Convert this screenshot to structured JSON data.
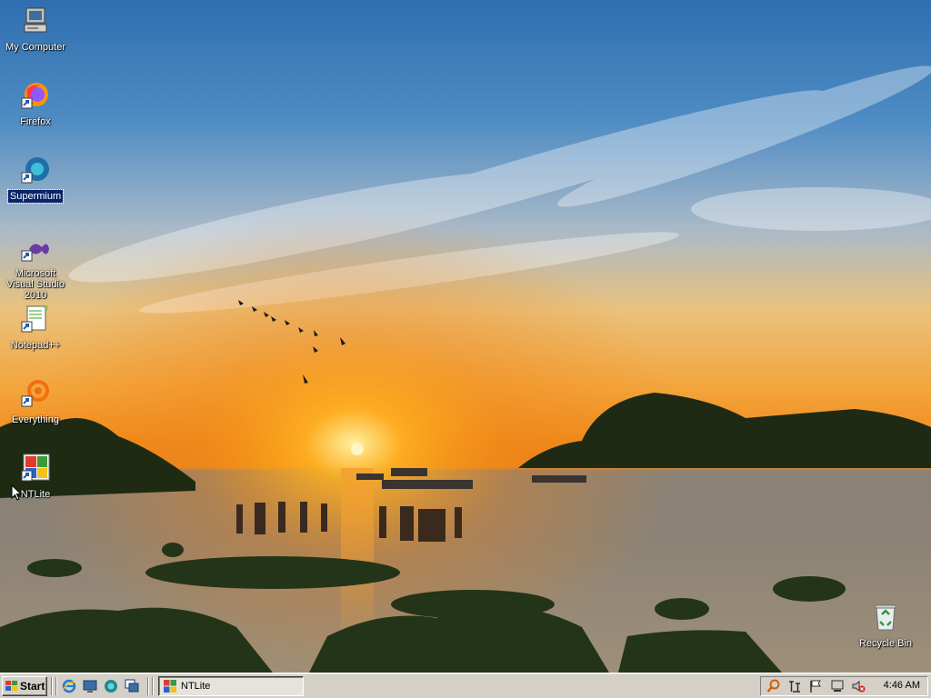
{
  "desktop": {
    "icons": [
      {
        "label": "My Computer",
        "icon": "my-computer-icon"
      },
      {
        "label": "Firefox",
        "icon": "firefox-icon"
      },
      {
        "label": "Supermium",
        "icon": "supermium-icon",
        "selected": true
      },
      {
        "label": "Microsoft Visual Studio 2010",
        "icon": "visual-studio-icon"
      },
      {
        "label": "Notepad++",
        "icon": "notepadpp-icon"
      },
      {
        "label": "Everything",
        "icon": "everything-icon"
      },
      {
        "label": "NTLite",
        "icon": "ntlite-icon"
      }
    ],
    "recycle_bin": {
      "label": "Recycle Bin",
      "icon": "recycle-bin-icon"
    }
  },
  "taskbar": {
    "start_label": "Start",
    "quick_launch": [
      "internet-explorer-icon",
      "show-desktop-icon",
      "supermium-icon",
      "window-switcher-icon"
    ],
    "tasks": [
      {
        "label": "NTLite",
        "icon": "ntlite-icon",
        "active": true
      }
    ],
    "tray_icons": [
      "search-icon",
      "network-icon",
      "action-center-flag-icon",
      "display-icon",
      "volume-muted-icon"
    ],
    "clock": "4:46 AM"
  },
  "colors": {
    "taskbar": "#d4d0c8",
    "selection": "#0a246a"
  }
}
